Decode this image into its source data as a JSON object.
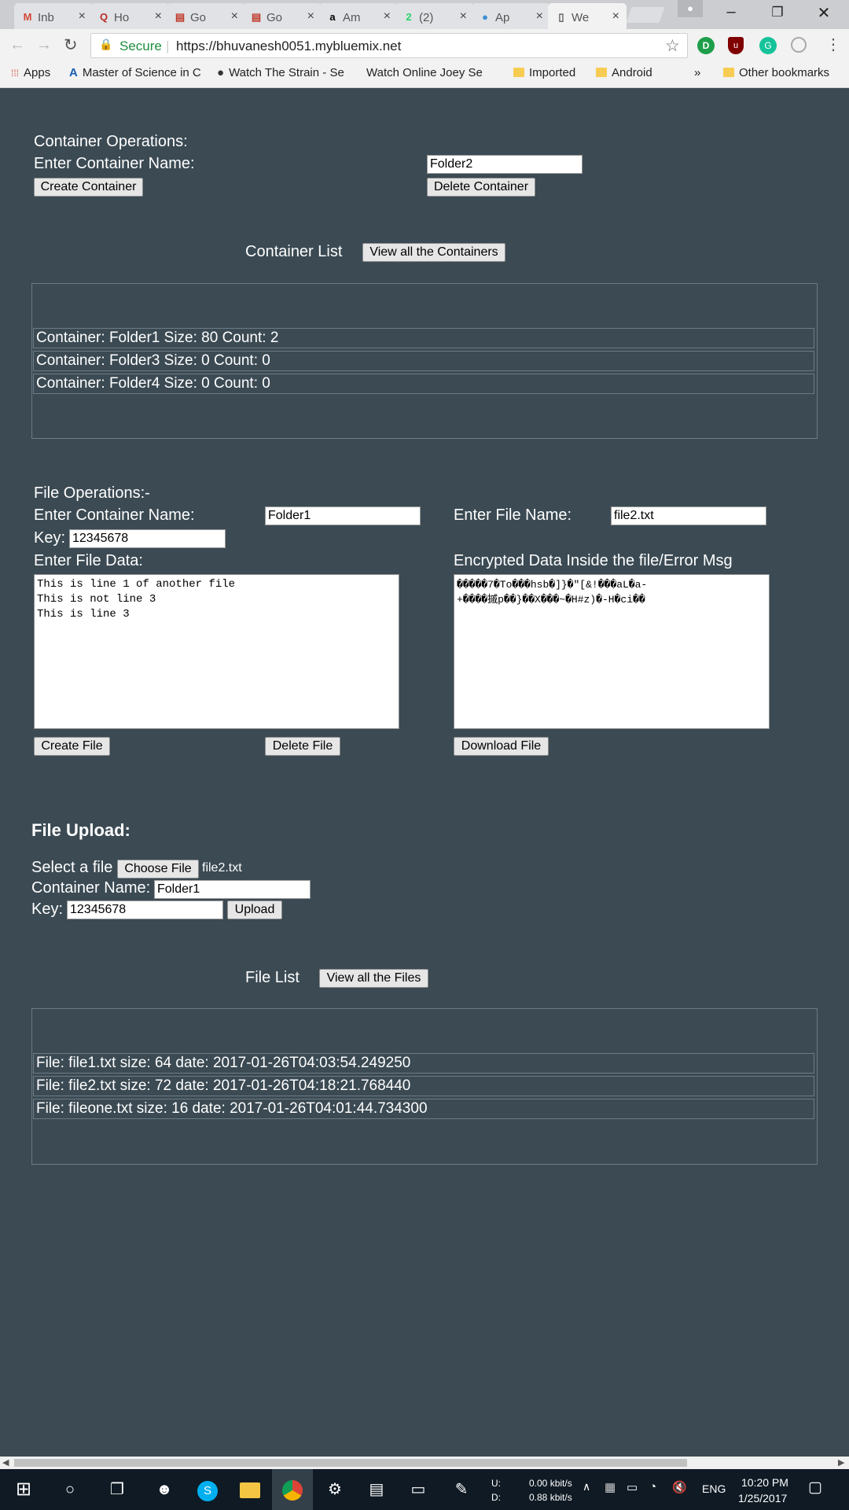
{
  "browser": {
    "tabs": [
      {
        "label": "Inb",
        "icon": "gmail-icon",
        "glyph": "M",
        "color": "#d44638"
      },
      {
        "label": "Ho",
        "icon": "quora-icon",
        "glyph": "Q",
        "color": "#b92b27"
      },
      {
        "label": "Go",
        "icon": "google-doc-icon",
        "glyph": "▤",
        "color": "#c0392b"
      },
      {
        "label": "Go",
        "icon": "google-doc-icon",
        "glyph": "▤",
        "color": "#c0392b"
      },
      {
        "label": "Am",
        "icon": "amazon-icon",
        "glyph": "a",
        "color": "#000000"
      },
      {
        "label": "(2)",
        "icon": "whatsapp-icon",
        "glyph": "2",
        "color": "#25d366"
      },
      {
        "label": "Ap",
        "icon": "app-icon",
        "glyph": "●",
        "color": "#3a8fd6"
      },
      {
        "label": "We",
        "icon": "page-icon",
        "glyph": "▯",
        "color": "#555555"
      }
    ],
    "secure_label": "Secure",
    "url": "https://bhuvanesh0051.mybluemix.net",
    "bookmarks": [
      {
        "label": "Apps",
        "icon": "apps-grid-icon"
      },
      {
        "label": "Master of Science in C",
        "icon": "bookmark-a-icon"
      },
      {
        "label": "Watch The Strain - Se",
        "icon": "bookmark-circle-icon"
      },
      {
        "label": "Watch Online Joey Se",
        "icon": ""
      },
      {
        "label": "Imported",
        "icon": "folder-icon"
      },
      {
        "label": "Android",
        "icon": "folder-icon"
      }
    ],
    "overflow": "»",
    "other_bookmarks": "Other bookmarks"
  },
  "container_ops": {
    "heading": "Container Operations:",
    "name_label": "Enter Container Name:",
    "name_value": "Folder2",
    "create_button": "Create Container",
    "delete_button": "Delete Container",
    "list_label": "Container List",
    "view_button": "View all the Containers",
    "items": [
      "Container: Folder1 Size: 80 Count: 2",
      "Container: Folder3 Size: 0 Count: 0",
      "Container: Folder4 Size: 0 Count: 0"
    ]
  },
  "file_ops": {
    "heading": "File Operations:-",
    "container_label": "Enter Container Name:",
    "container_value": "Folder1",
    "file_label": "Enter File Name:",
    "file_value": "file2.txt",
    "key_label": "Key:",
    "key_value": "12345678",
    "data_label": "Enter File Data:",
    "data_value": "This is line 1 of another file\nThis is not line 3\nThis is line 3",
    "encrypted_label": "Encrypted Data Inside the file/Error Msg",
    "encrypted_value": "�����7�To���hsb�]}�\"[&!���aL�a-\n+����摵p��}��X���~�H#z)�-H�ci��",
    "create_button": "Create File",
    "delete_button": "Delete File",
    "download_button": "Download File"
  },
  "upload": {
    "heading": "File Upload:",
    "select_label": "Select a file",
    "choose_button": "Choose File",
    "chosen_file": "file2.txt",
    "container_label": "Container Name:",
    "container_value": "Folder1",
    "key_label": "Key:",
    "key_value": "12345678",
    "upload_button": "Upload"
  },
  "file_list": {
    "label": "File List",
    "view_button": "View all the Files",
    "items": [
      "File: file1.txt size: 64 date: 2017-01-26T04:03:54.249250",
      "File: file2.txt size: 72 date: 2017-01-26T04:18:21.768440",
      "File: fileone.txt size: 16 date: 2017-01-26T04:01:44.734300"
    ]
  },
  "taskbar": {
    "net_up_label": "U:",
    "net_down_label": "D:",
    "net_up": "0.00 kbit/s",
    "net_down": "0.88 kbit/s",
    "lang": "ENG",
    "time": "10:20 PM",
    "date": "1/25/2017"
  }
}
